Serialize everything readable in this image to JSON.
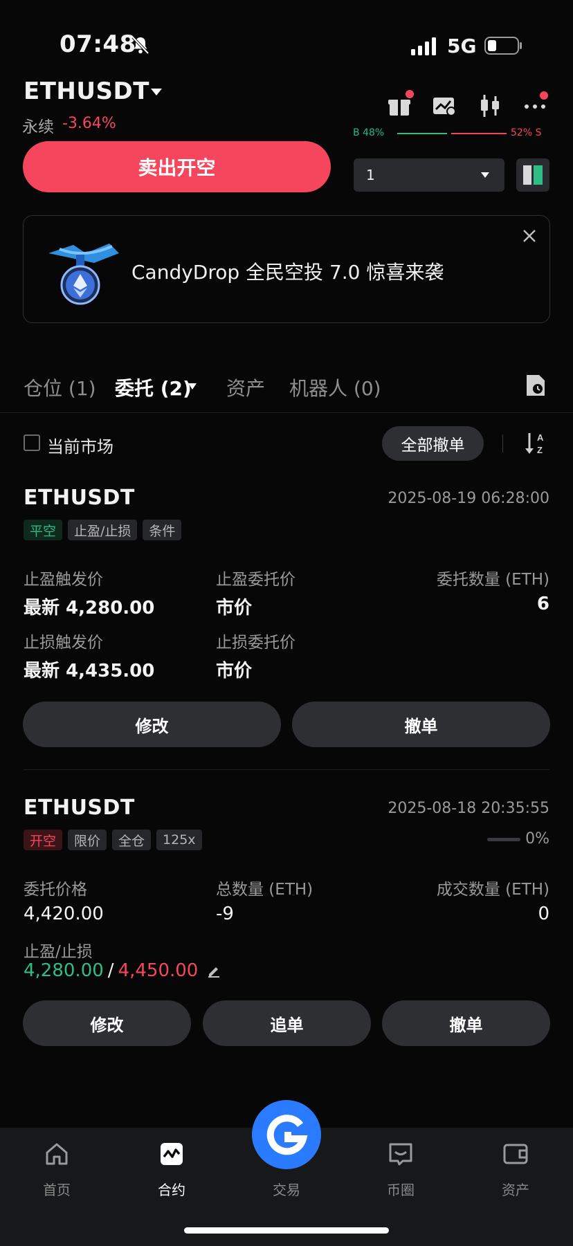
{
  "status_bar": {
    "time": "07:48",
    "network": "5G"
  },
  "header": {
    "symbol": "ETHUSDT",
    "contract_type": "永续",
    "change": "-3.64%",
    "legend_buy": "B 48%",
    "legend_sell": "52% S"
  },
  "trade": {
    "sell_button": "卖出开空",
    "quantity": "1"
  },
  "banner": {
    "text": "CandyDrop 全民空投 7.0 惊喜来袭"
  },
  "tabs": [
    {
      "label": "仓位 (1)"
    },
    {
      "label": "委托 (2)"
    },
    {
      "label": "资产"
    },
    {
      "label": "机器人 (0)"
    }
  ],
  "filter": {
    "current_market": "当前市场",
    "cancel_all": "全部撤单"
  },
  "orders": [
    {
      "symbol": "ETHUSDT",
      "time": "2025-08-19 06:28:00",
      "tags": [
        "平空",
        "止盈/止损",
        "条件"
      ],
      "tp_trigger_label": "止盈触发价",
      "tp_trigger_value": "最新 4,280.00",
      "tp_order_label": "止盈委托价",
      "tp_order_value": "市价",
      "qty_label": "委托数量 (ETH)",
      "qty_value": "6",
      "sl_trigger_label": "止损触发价",
      "sl_trigger_value": "最新 4,435.00",
      "sl_order_label": "止损委托价",
      "sl_order_value": "市价",
      "btn_modify": "修改",
      "btn_cancel": "撤单"
    },
    {
      "symbol": "ETHUSDT",
      "time": "2025-08-18 20:35:55",
      "tags": [
        "开空",
        "限价",
        "全仓",
        "125x"
      ],
      "progress": "0%",
      "price_label": "委托价格",
      "price_value": "4,420.00",
      "total_label": "总数量 (ETH)",
      "total_value": "-9",
      "filled_label": "成交数量 (ETH)",
      "filled_value": "0",
      "tpsl_label": "止盈/止损",
      "tp_value": "4,280.00",
      "tpsl_sep": "/",
      "sl_value": "4,450.00",
      "btn_modify": "修改",
      "btn_chase": "追单",
      "btn_cancel": "撤单"
    }
  ],
  "nav": [
    {
      "label": "首页",
      "icon": "home-icon"
    },
    {
      "label": "合约",
      "icon": "futures-icon"
    },
    {
      "label": "交易",
      "icon": "trade-icon"
    },
    {
      "label": "币圈",
      "icon": "community-icon"
    },
    {
      "label": "资产",
      "icon": "wallet-icon"
    }
  ],
  "colors": {
    "buy": "#2ebd85",
    "sell": "#f6465d",
    "accent": "#2a7bff"
  }
}
